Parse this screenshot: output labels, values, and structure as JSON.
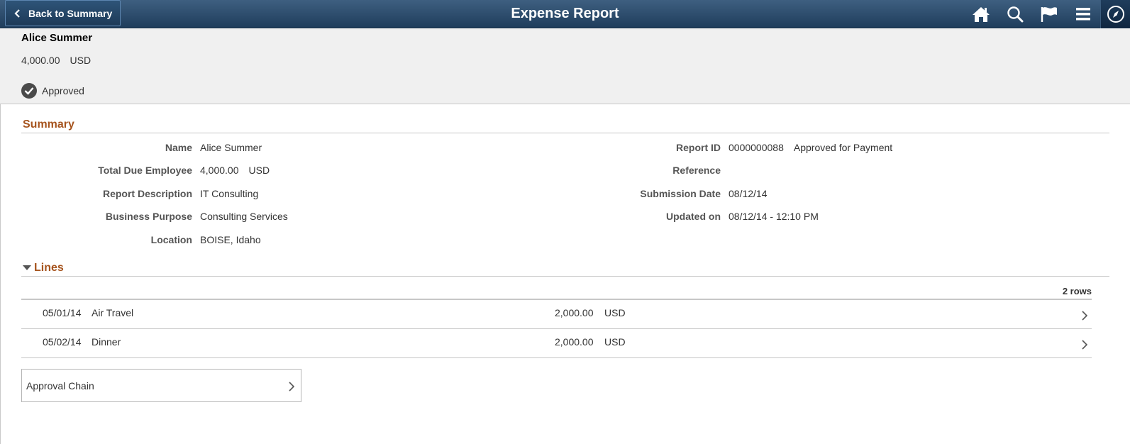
{
  "header": {
    "back_label": "Back to Summary",
    "title": "Expense Report",
    "icons": [
      "home-icon",
      "search-icon",
      "flag-icon",
      "menu-icon",
      "navbar-compass-icon"
    ]
  },
  "banner": {
    "name": "Alice Summer",
    "amount": "4,000.00",
    "currency": "USD",
    "status": "Approved"
  },
  "summary": {
    "title": "Summary",
    "left": [
      {
        "label": "Name",
        "value": "Alice Summer"
      },
      {
        "label": "Total Due Employee",
        "value": "4,000.00",
        "currency": "USD"
      },
      {
        "label": "Report Description",
        "value": "IT Consulting"
      },
      {
        "label": "Business Purpose",
        "value": "Consulting Services"
      },
      {
        "label": "Location",
        "value": "BOISE, Idaho"
      }
    ],
    "right": [
      {
        "label": "Report ID",
        "value": "0000000088",
        "extra": "Approved for Payment"
      },
      {
        "label": "Reference",
        "value": ""
      },
      {
        "label": "Submission Date",
        "value": "08/12/14"
      },
      {
        "label": "Updated on",
        "value": "08/12/14 - 12:10 PM"
      }
    ]
  },
  "lines": {
    "title": "Lines",
    "row_count": "2 rows",
    "rows": [
      {
        "date": "05/01/14",
        "description": "Air Travel",
        "amount": "2,000.00",
        "currency": "USD"
      },
      {
        "date": "05/02/14",
        "description": "Dinner",
        "amount": "2,000.00",
        "currency": "USD"
      }
    ]
  },
  "approval": {
    "label": "Approval Chain"
  },
  "colors": {
    "header_top": "#3e5f80",
    "header_bottom": "#1f3d5c",
    "section_title": "#a6541e",
    "banner_bg": "#f0f0f0"
  }
}
